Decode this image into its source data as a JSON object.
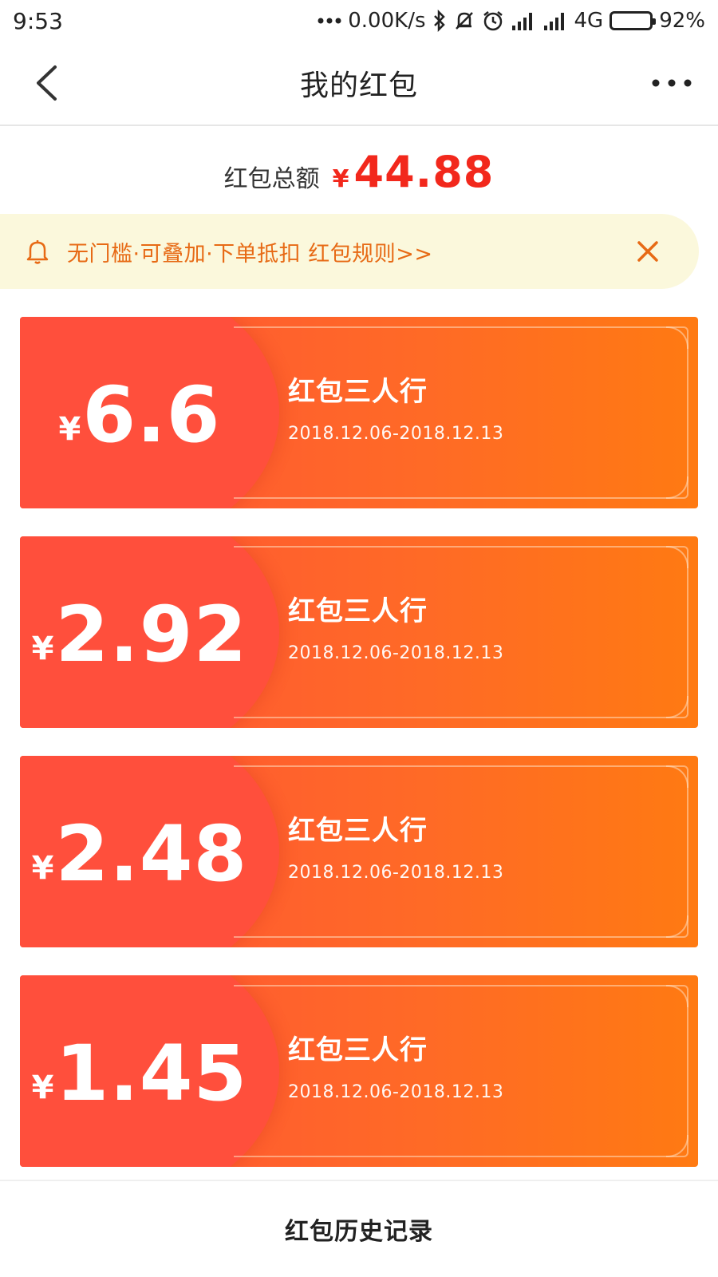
{
  "status_bar": {
    "time": "9:53",
    "network_speed": "0.00K/s",
    "network_type": "4G",
    "battery": "92%",
    "icons": [
      "dots-icon",
      "bluetooth-icon",
      "mute-icon",
      "alarm-icon",
      "signal-icon",
      "signal-icon"
    ]
  },
  "nav": {
    "title": "我的红包",
    "back_icon": "chevron-left-icon",
    "more_icon": "more-dots-icon"
  },
  "total": {
    "label": "红包总额",
    "currency": "¥",
    "amount": "44.88"
  },
  "notice": {
    "icon": "bell-icon",
    "text": "无门槛·可叠加·下单抵扣 红包规则>>",
    "close_icon": "close-icon",
    "color": "#e76a15",
    "background": "#fbf8dc"
  },
  "cards": [
    {
      "currency": "¥",
      "amount": "6.6",
      "title": "红包三人行",
      "date": "2018.12.06-2018.12.13"
    },
    {
      "currency": "¥",
      "amount": "2.92",
      "title": "红包三人行",
      "date": "2018.12.06-2018.12.13"
    },
    {
      "currency": "¥",
      "amount": "2.48",
      "title": "红包三人行",
      "date": "2018.12.06-2018.12.13"
    },
    {
      "currency": "¥",
      "amount": "1.45",
      "title": "红包三人行",
      "date": "2018.12.06-2018.12.13"
    }
  ],
  "bottom": {
    "history_label": "红包历史记录"
  },
  "colors": {
    "accent_red": "#f2281c",
    "card_start": "#ff5238",
    "card_end": "#ff7a12"
  }
}
